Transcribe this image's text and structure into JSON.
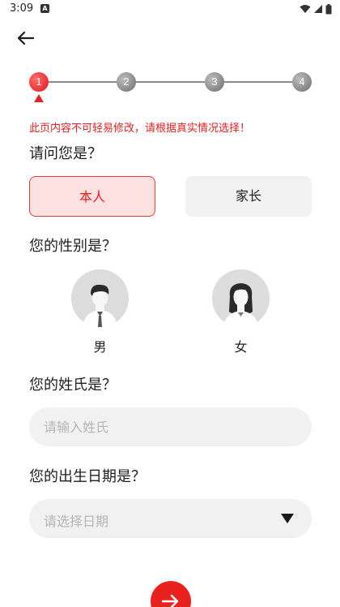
{
  "status_bar": {
    "time": "3:09",
    "notification_badge": "A"
  },
  "stepper": {
    "steps": [
      "1",
      "2",
      "3",
      "4"
    ],
    "current_step": 1,
    "active_color": "#e62222",
    "inactive_color": "#7a7a7a"
  },
  "warning": "此页内容不可轻易修改，请根据真实情况选择！",
  "identity": {
    "question": "请问您是？",
    "options": [
      {
        "label": "本人",
        "selected": true
      },
      {
        "label": "家长",
        "selected": false
      }
    ]
  },
  "gender": {
    "question": "您的性别是？",
    "options": [
      {
        "label": "男",
        "icon": "male-avatar-icon"
      },
      {
        "label": "女",
        "icon": "female-avatar-icon"
      }
    ]
  },
  "surname": {
    "question": "您的姓氏是？",
    "placeholder": "请输入姓氏",
    "value": ""
  },
  "birthdate": {
    "question": "您的出生日期是？",
    "placeholder": "请选择日期"
  },
  "colors": {
    "accent": "#e8231f",
    "selected_bg": "#fde0e0",
    "field_bg": "#f1f1f1"
  }
}
